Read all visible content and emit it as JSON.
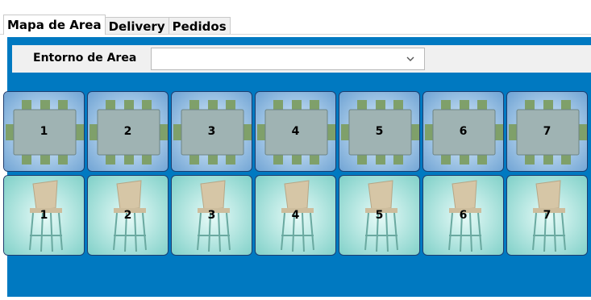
{
  "tabs": [
    "Mapa de Area",
    "Delivery",
    "Pedidos"
  ],
  "toolbar": {
    "label": "Entorno de Area",
    "combo_value": ""
  },
  "mesas": [
    "1",
    "2",
    "3",
    "4",
    "5",
    "6",
    "7"
  ],
  "barras": [
    "1",
    "2",
    "3",
    "4",
    "5",
    "6",
    "7"
  ],
  "colors": {
    "panel": "#0079c1",
    "toolbar": "#f0f0f0"
  }
}
